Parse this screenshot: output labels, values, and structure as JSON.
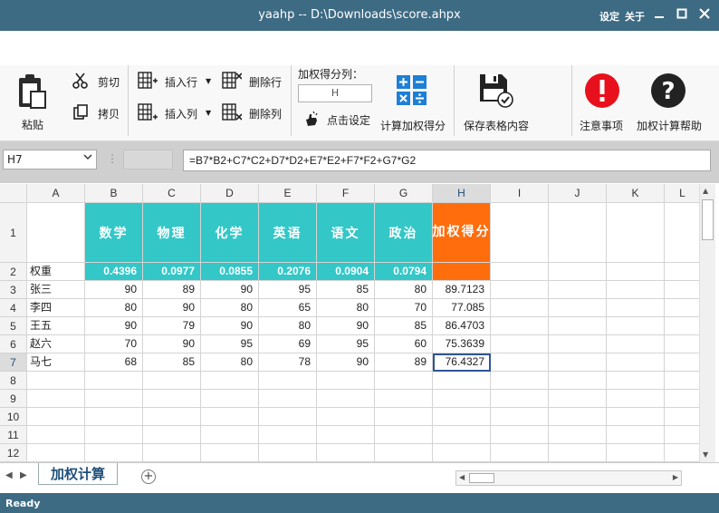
{
  "window": {
    "title": "yaahp -- D:\\Downloads\\score.ahpx",
    "menu": [
      "设定",
      "关于"
    ]
  },
  "ribbon": {
    "paste": "粘贴",
    "cut": "剪切",
    "copy": "拷贝",
    "insert_row": "插入行",
    "insert_col": "插入列",
    "delete_row": "删除行",
    "delete_col": "删除列",
    "score_column_label": "加权得分列：",
    "score_column_value": "H",
    "click_set": "点击设定",
    "calc_weighted": "计算加权得分",
    "save_table": "保存表格内容",
    "notes": "注意事项",
    "help": "加权计算帮助"
  },
  "formula_bar": {
    "name_box": "H7",
    "formula": "=B7*B2+C7*C2+D7*D2+E7*E2+F7*F2+G7*G2"
  },
  "sheet": {
    "columns": [
      "A",
      "B",
      "C",
      "D",
      "E",
      "F",
      "G",
      "H",
      "I",
      "J",
      "K",
      "L"
    ],
    "rows": [
      "1",
      "2",
      "3",
      "4",
      "5",
      "6",
      "7",
      "8",
      "9",
      "10",
      "11",
      "12"
    ],
    "headers": [
      "数学",
      "物理",
      "化学",
      "英语",
      "语文",
      "政治",
      "加权得分"
    ],
    "weight_label": "权重",
    "weights": [
      "0.4396",
      "0.0977",
      "0.0855",
      "0.2076",
      "0.0904",
      "0.0794"
    ],
    "data": [
      {
        "name": "张三",
        "scores": [
          "90",
          "89",
          "90",
          "95",
          "85",
          "80"
        ],
        "result": "89.7123"
      },
      {
        "name": "李四",
        "scores": [
          "80",
          "90",
          "80",
          "65",
          "80",
          "70"
        ],
        "result": "77.085"
      },
      {
        "name": "王五",
        "scores": [
          "90",
          "79",
          "90",
          "80",
          "90",
          "85"
        ],
        "result": "86.4703"
      },
      {
        "name": "赵六",
        "scores": [
          "70",
          "90",
          "95",
          "69",
          "95",
          "60"
        ],
        "result": "75.3639"
      },
      {
        "name": "马七",
        "scores": [
          "68",
          "85",
          "80",
          "78",
          "90",
          "89"
        ],
        "result": "76.4327"
      }
    ],
    "selected_cell": "H7"
  },
  "tabs": {
    "active": "加权计算"
  },
  "status": {
    "text": "Ready"
  },
  "colors": {
    "header_teal": "#33c7c7",
    "header_orange": "#ff6d0d",
    "title_bar": "#3e6b84"
  }
}
